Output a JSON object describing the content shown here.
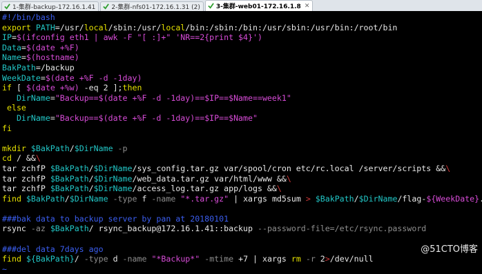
{
  "tabs": [
    {
      "label": "1-集群-backup-172.16.1.41",
      "active": false
    },
    {
      "label": "2-集群-nfs01-172.16.1.31 (2)",
      "active": false
    },
    {
      "label": "3-集群-web01-172.16.1.8",
      "active": true
    }
  ],
  "colors": {
    "comment": "#3b5ef0",
    "keyword": "#e5e100",
    "string": "#d84cd8",
    "variable": "#22c7c7",
    "option": "#8e8e8e",
    "path": "#30d030",
    "special": "#d23a3a"
  },
  "terminal": {
    "lines": [
      [
        [
          "c-comment",
          "#!/bin/bash"
        ]
      ],
      [
        [
          "c-yellow",
          "export"
        ],
        [
          "c-white",
          " "
        ],
        [
          "c-cyan",
          "PATH"
        ],
        [
          "c-white",
          "=/usr/"
        ],
        [
          "c-yellow",
          "local"
        ],
        [
          "c-white",
          "/sbin:/usr/"
        ],
        [
          "c-yellow",
          "local"
        ],
        [
          "c-white",
          "/bin:/sbin:/bin:/usr/sbin:/usr/bin:/root/bin"
        ]
      ],
      [
        [
          "c-cyan",
          "IP"
        ],
        [
          "c-white",
          "="
        ],
        [
          "c-magenta",
          "$(ifconfig eth1 | awk -F \"[ :]+\" 'NR==2{print $4}')"
        ]
      ],
      [
        [
          "c-cyan",
          "Data"
        ],
        [
          "c-white",
          "="
        ],
        [
          "c-magenta",
          "$(date +%F)"
        ]
      ],
      [
        [
          "c-cyan",
          "Name"
        ],
        [
          "c-white",
          "="
        ],
        [
          "c-magenta",
          "$(hostname)"
        ]
      ],
      [
        [
          "c-cyan",
          "BakPath"
        ],
        [
          "c-white",
          "=/backup"
        ]
      ],
      [
        [
          "c-cyan",
          "WeekDate"
        ],
        [
          "c-white",
          "="
        ],
        [
          "c-magenta",
          "$(date +%F -d -1day)"
        ]
      ],
      [
        [
          "c-yellow",
          "if"
        ],
        [
          "c-white",
          " [ "
        ],
        [
          "c-magenta",
          "$(date +%w)"
        ],
        [
          "c-white",
          " -eq 2 ];"
        ],
        [
          "c-yellow",
          "then"
        ]
      ],
      [
        [
          "c-white",
          "   "
        ],
        [
          "c-cyan",
          "DirName"
        ],
        [
          "c-white",
          "="
        ],
        [
          "c-magenta",
          "\"Backup==$(date +%F -d -1day)==$IP==$Name==week1\""
        ]
      ],
      [
        [
          "c-white",
          " "
        ],
        [
          "c-yellow",
          "else"
        ]
      ],
      [
        [
          "c-white",
          "   "
        ],
        [
          "c-cyan",
          "DirName"
        ],
        [
          "c-white",
          "="
        ],
        [
          "c-magenta",
          "\"Backup==$(date +%F -d -1day)==$IP==$Name\""
        ]
      ],
      [
        [
          "c-yellow",
          "fi"
        ]
      ],
      [
        [
          "c-white",
          ""
        ]
      ],
      [
        [
          "c-yellow",
          "mkdir"
        ],
        [
          "c-white",
          " "
        ],
        [
          "c-cyan",
          "$BakPath"
        ],
        [
          "c-white",
          "/"
        ],
        [
          "c-cyan",
          "$DirName"
        ],
        [
          "c-white",
          " "
        ],
        [
          "c-gray",
          "-p"
        ]
      ],
      [
        [
          "c-yellow",
          "cd"
        ],
        [
          "c-white",
          " / &&"
        ],
        [
          "c-red",
          "\\"
        ]
      ],
      [
        [
          "c-white",
          "tar zchfP "
        ],
        [
          "c-cyan",
          "$BakPath"
        ],
        [
          "c-white",
          "/"
        ],
        [
          "c-cyan",
          "$DirName"
        ],
        [
          "c-white",
          "/sys_config.tar.gz var/spool/cron etc/rc.local /server/scripts &&"
        ],
        [
          "c-red",
          "\\"
        ]
      ],
      [
        [
          "c-white",
          "tar zchfP "
        ],
        [
          "c-cyan",
          "$BakPath"
        ],
        [
          "c-white",
          "/"
        ],
        [
          "c-cyan",
          "$DirName"
        ],
        [
          "c-white",
          "/web_data.tar.gz var/html/www &&"
        ],
        [
          "c-red",
          "\\"
        ]
      ],
      [
        [
          "c-white",
          "tar zchfP "
        ],
        [
          "c-cyan",
          "$BakPath"
        ],
        [
          "c-white",
          "/"
        ],
        [
          "c-cyan",
          "$DirName"
        ],
        [
          "c-white",
          "/access_log.tar.gz app/logs &&"
        ],
        [
          "c-red",
          "\\"
        ]
      ],
      [
        [
          "c-yellow",
          "find"
        ],
        [
          "c-white",
          " "
        ],
        [
          "c-cyan",
          "$BakPath"
        ],
        [
          "c-white",
          "/"
        ],
        [
          "c-cyan",
          "$DirName"
        ],
        [
          "c-white",
          " "
        ],
        [
          "c-gray",
          "-type"
        ],
        [
          "c-white",
          " f "
        ],
        [
          "c-gray",
          "-name"
        ],
        [
          "c-white",
          " "
        ],
        [
          "c-magenta",
          "\"*.tar.gz\""
        ],
        [
          "c-white",
          " | xargs md5sum "
        ],
        [
          "c-red",
          ">"
        ],
        [
          "c-white",
          " "
        ],
        [
          "c-cyan",
          "$BakPath"
        ],
        [
          "c-white",
          "/"
        ],
        [
          "c-cyan",
          "$DirName"
        ],
        [
          "c-white",
          "/flag-"
        ],
        [
          "c-magenta",
          "${WeekDate}"
        ],
        [
          "c-white",
          ".log"
        ]
      ],
      [
        [
          "c-white",
          ""
        ]
      ],
      [
        [
          "c-comment",
          "###bak data to backup server by pan at 20180101"
        ]
      ],
      [
        [
          "c-white",
          "rsync "
        ],
        [
          "c-gray",
          "-az"
        ],
        [
          "c-white",
          " "
        ],
        [
          "c-cyan",
          "$BakPath"
        ],
        [
          "c-white",
          "/ rsync_backup@172.16.1.41::backup "
        ],
        [
          "c-gray",
          "--password-file=/etc/rsync.password"
        ]
      ],
      [
        [
          "c-white",
          ""
        ]
      ],
      [
        [
          "c-comment",
          "###del data 7days ago"
        ]
      ],
      [
        [
          "c-yellow",
          "find"
        ],
        [
          "c-white",
          " "
        ],
        [
          "c-cyan",
          "${BakPath}"
        ],
        [
          "c-white",
          "/ "
        ],
        [
          "c-gray",
          "-type"
        ],
        [
          "c-white",
          " d "
        ],
        [
          "c-gray",
          "-name"
        ],
        [
          "c-white",
          " "
        ],
        [
          "c-magenta",
          "\"*Backup*\""
        ],
        [
          "c-white",
          " "
        ],
        [
          "c-gray",
          "-mtime"
        ],
        [
          "c-white",
          " +7 | xargs "
        ],
        [
          "c-yellow",
          "rm"
        ],
        [
          "c-white",
          " "
        ],
        [
          "c-gray",
          "-r"
        ],
        [
          "c-white",
          " 2"
        ],
        [
          "c-red",
          ">"
        ],
        [
          "c-white",
          "/dev/null"
        ]
      ],
      [
        [
          "c-comment",
          "~"
        ]
      ]
    ]
  },
  "watermark": "@51CTO博客"
}
